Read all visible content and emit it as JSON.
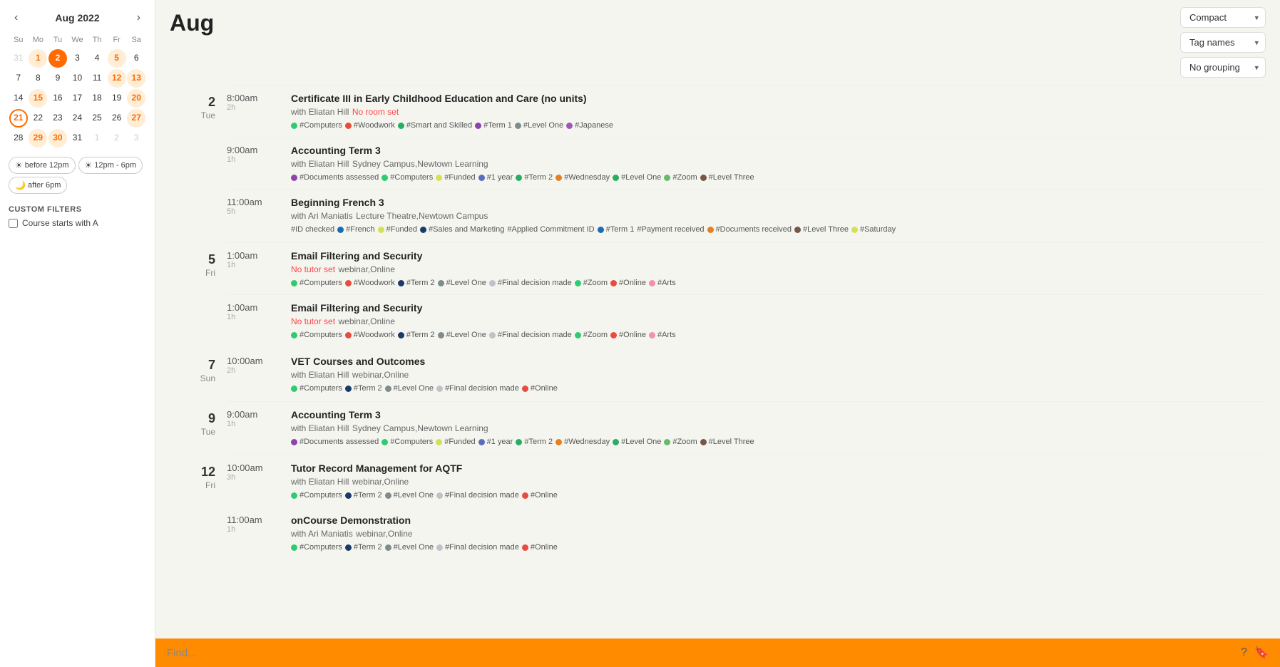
{
  "sidebar": {
    "prev_arrow": "‹",
    "next_arrow": "›",
    "month_year": "Aug 2022",
    "day_headers": [
      "Su",
      "Mo",
      "Tu",
      "We",
      "Th",
      "Fr",
      "Sa"
    ],
    "weeks": [
      [
        {
          "day": "31",
          "state": "other-month"
        },
        {
          "day": "1",
          "state": "highlighted"
        },
        {
          "day": "2",
          "state": "today"
        },
        {
          "day": "3",
          "state": ""
        },
        {
          "day": "4",
          "state": ""
        },
        {
          "day": "5",
          "state": "highlighted"
        },
        {
          "day": "6",
          "state": ""
        }
      ],
      [
        {
          "day": "7",
          "state": ""
        },
        {
          "day": "8",
          "state": ""
        },
        {
          "day": "9",
          "state": ""
        },
        {
          "day": "10",
          "state": ""
        },
        {
          "day": "11",
          "state": ""
        },
        {
          "day": "12",
          "state": "highlighted"
        },
        {
          "day": "13",
          "state": "highlighted"
        }
      ],
      [
        {
          "day": "14",
          "state": ""
        },
        {
          "day": "15",
          "state": "highlighted"
        },
        {
          "day": "16",
          "state": ""
        },
        {
          "day": "17",
          "state": ""
        },
        {
          "day": "18",
          "state": ""
        },
        {
          "day": "19",
          "state": ""
        },
        {
          "day": "20",
          "state": "highlighted"
        }
      ],
      [
        {
          "day": "21",
          "state": "today-outline"
        },
        {
          "day": "22",
          "state": ""
        },
        {
          "day": "23",
          "state": ""
        },
        {
          "day": "24",
          "state": ""
        },
        {
          "day": "25",
          "state": ""
        },
        {
          "day": "26",
          "state": ""
        },
        {
          "day": "27",
          "state": "highlighted"
        }
      ],
      [
        {
          "day": "28",
          "state": ""
        },
        {
          "day": "29",
          "state": "highlighted"
        },
        {
          "day": "30",
          "state": "highlighted"
        },
        {
          "day": "31",
          "state": ""
        },
        {
          "day": "1",
          "state": "other-month"
        },
        {
          "day": "2",
          "state": "other-month"
        },
        {
          "day": "3",
          "state": "other-month"
        }
      ]
    ],
    "time_filters": [
      {
        "label": "before 12pm",
        "icon": "☀"
      },
      {
        "label": "12pm - 6pm",
        "icon": "☀"
      },
      {
        "label": "after 6pm",
        "icon": "🌙"
      }
    ],
    "custom_filters_title": "CUSTOM FILTERS",
    "custom_filters": [
      {
        "label": "Course starts with A",
        "checked": false
      }
    ]
  },
  "header": {
    "month": "Aug",
    "compact_label": "Compact",
    "tag_names_label": "Tag names",
    "no_grouping_label": "No grouping"
  },
  "schedule": [
    {
      "date_num": "2",
      "date_day": "Tue",
      "events": [
        {
          "time": "8:00am",
          "duration": "2h",
          "title": "Certificate III in Early Childhood Education and Care (no units)",
          "tutor": "with Eliatan Hill",
          "room": "No room set",
          "location": "",
          "tags": [
            {
              "color": "#2ecc71",
              "label": "#Computers"
            },
            {
              "color": "#e74c3c",
              "label": "#Woodwork"
            },
            {
              "color": "#27ae60",
              "label": "#Smart and Skilled"
            },
            {
              "color": "#8e44ad",
              "label": "#Term 1"
            },
            {
              "color": "#7f8c8d",
              "label": "#Level One"
            },
            {
              "color": "#9b59b6",
              "label": "#Japanese"
            }
          ]
        },
        {
          "time": "9:00am",
          "duration": "1h",
          "title": "Accounting Term 3",
          "tutor": "with Eliatan Hill",
          "room": "",
          "location": "Sydney Campus,Newtown Learning",
          "tags": [
            {
              "color": "#8e44ad",
              "label": "#Documents assessed"
            },
            {
              "color": "#2ecc71",
              "label": "#Computers"
            },
            {
              "color": "#d4e157",
              "label": "#Funded"
            },
            {
              "color": "#5c6bc0",
              "label": "#1 year"
            },
            {
              "color": "#27ae60",
              "label": "#Term 2"
            },
            {
              "color": "#e67e22",
              "label": "#Wednesday"
            },
            {
              "color": "#27ae60",
              "label": "#Level One"
            },
            {
              "color": "#66bb6a",
              "label": "#Zoom"
            },
            {
              "color": "#795548",
              "label": "#Level Three"
            }
          ]
        },
        {
          "time": "11:00am",
          "duration": "5h",
          "title": "Beginning French 3",
          "tutor": "with Ari Maniatis",
          "room": "",
          "location": "Lecture Theatre,Newtown Campus",
          "tags": [
            {
              "color": "",
              "label": "#ID checked"
            },
            {
              "color": "#1a6bb5",
              "label": "#French"
            },
            {
              "color": "#d4e157",
              "label": "#Funded"
            },
            {
              "color": "#1a3a6b",
              "label": "#Sales and Marketing"
            },
            {
              "color": "",
              "label": "#Applied Commitment ID"
            },
            {
              "color": "#1a6bb5",
              "label": "#Term 1"
            },
            {
              "color": "",
              "label": "#Payment received"
            },
            {
              "color": "#e67e22",
              "label": "#Documents received"
            },
            {
              "color": "#795548",
              "label": "#Level Three"
            },
            {
              "color": "#d4e157",
              "label": "#Saturday"
            }
          ]
        }
      ]
    },
    {
      "date_num": "5",
      "date_day": "Fri",
      "events": [
        {
          "time": "1:00am",
          "duration": "1h",
          "title": "Email Filtering and Security",
          "tutor": "",
          "no_tutor": "No tutor set",
          "room": "",
          "location": "webinar,Online",
          "tags": [
            {
              "color": "#2ecc71",
              "label": "#Computers"
            },
            {
              "color": "#e74c3c",
              "label": "#Woodwork"
            },
            {
              "color": "#1a3a6b",
              "label": "#Term 2"
            },
            {
              "color": "#7f8c8d",
              "label": "#Level One"
            },
            {
              "color": "#bdc3c7",
              "label": "#Final decision made"
            },
            {
              "color": "#2ecc71",
              "label": "#Zoom"
            },
            {
              "color": "#e74c3c",
              "label": "#Online"
            },
            {
              "color": "#f48fb1",
              "label": "#Arts"
            }
          ]
        },
        {
          "time": "1:00am",
          "duration": "1h",
          "title": "Email Filtering and Security",
          "tutor": "",
          "no_tutor": "No tutor set",
          "room": "",
          "location": "webinar,Online",
          "tags": [
            {
              "color": "#2ecc71",
              "label": "#Computers"
            },
            {
              "color": "#e74c3c",
              "label": "#Woodwork"
            },
            {
              "color": "#1a3a6b",
              "label": "#Term 2"
            },
            {
              "color": "#7f8c8d",
              "label": "#Level One"
            },
            {
              "color": "#bdc3c7",
              "label": "#Final decision made"
            },
            {
              "color": "#2ecc71",
              "label": "#Zoom"
            },
            {
              "color": "#e74c3c",
              "label": "#Online"
            },
            {
              "color": "#f48fb1",
              "label": "#Arts"
            }
          ]
        }
      ]
    },
    {
      "date_num": "7",
      "date_day": "Sun",
      "events": [
        {
          "time": "10:00am",
          "duration": "2h",
          "title": "VET Courses and Outcomes",
          "tutor": "with Eliatan Hill",
          "room": "",
          "location": "webinar,Online",
          "tags": [
            {
              "color": "#2ecc71",
              "label": "#Computers"
            },
            {
              "color": "#1a3a6b",
              "label": "#Term 2"
            },
            {
              "color": "#7f8c8d",
              "label": "#Level One"
            },
            {
              "color": "#bdc3c7",
              "label": "#Final decision made"
            },
            {
              "color": "#e74c3c",
              "label": "#Online"
            }
          ]
        }
      ]
    },
    {
      "date_num": "9",
      "date_day": "Tue",
      "events": [
        {
          "time": "9:00am",
          "duration": "1h",
          "title": "Accounting Term 3",
          "tutor": "with Eliatan Hill",
          "room": "",
          "location": "Sydney Campus,Newtown Learning",
          "tags": [
            {
              "color": "#8e44ad",
              "label": "#Documents assessed"
            },
            {
              "color": "#2ecc71",
              "label": "#Computers"
            },
            {
              "color": "#d4e157",
              "label": "#Funded"
            },
            {
              "color": "#5c6bc0",
              "label": "#1 year"
            },
            {
              "color": "#27ae60",
              "label": "#Term 2"
            },
            {
              "color": "#e67e22",
              "label": "#Wednesday"
            },
            {
              "color": "#27ae60",
              "label": "#Level One"
            },
            {
              "color": "#66bb6a",
              "label": "#Zoom"
            },
            {
              "color": "#795548",
              "label": "#Level Three"
            }
          ]
        }
      ]
    },
    {
      "date_num": "12",
      "date_day": "Fri",
      "events": [
        {
          "time": "10:00am",
          "duration": "3h",
          "title": "Tutor Record Management for AQTF",
          "tutor": "with Eliatan Hill",
          "room": "",
          "location": "webinar,Online",
          "tags": [
            {
              "color": "#2ecc71",
              "label": "#Computers"
            },
            {
              "color": "#1a3a6b",
              "label": "#Term 2"
            },
            {
              "color": "#7f8c8d",
              "label": "#Level One"
            },
            {
              "color": "#bdc3c7",
              "label": "#Final decision made"
            },
            {
              "color": "#e74c3c",
              "label": "#Online"
            }
          ]
        },
        {
          "time": "11:00am",
          "duration": "1h",
          "title": "onCourse Demonstration",
          "tutor": "with Ari Maniatis",
          "room": "",
          "location": "webinar,Online",
          "tags": [
            {
              "color": "#2ecc71",
              "label": "#Computers"
            },
            {
              "color": "#1a3a6b",
              "label": "#Term 2"
            },
            {
              "color": "#7f8c8d",
              "label": "#Level One"
            },
            {
              "color": "#bdc3c7",
              "label": "#Final decision made"
            },
            {
              "color": "#e74c3c",
              "label": "#Online"
            }
          ]
        }
      ]
    }
  ],
  "search": {
    "placeholder": "Find..."
  }
}
